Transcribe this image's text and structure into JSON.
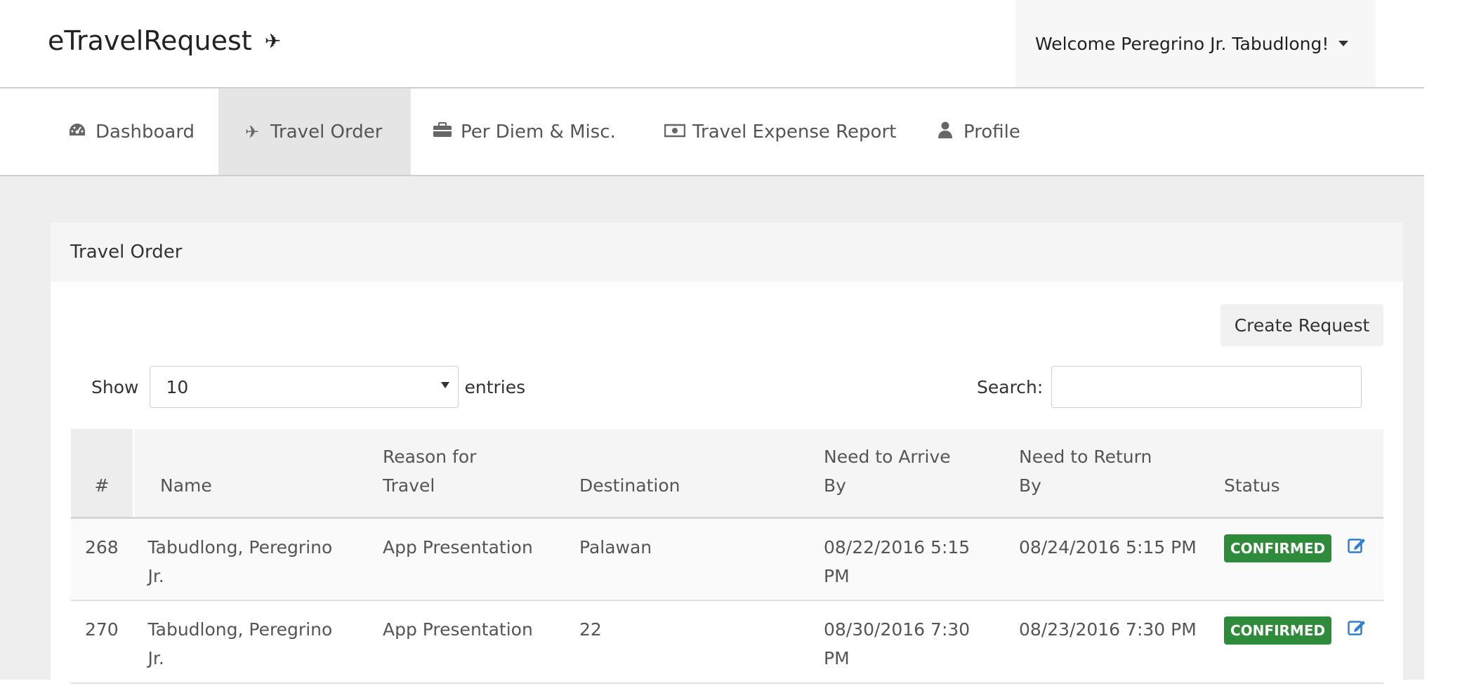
{
  "app": {
    "title": "eTravelRequest",
    "brand_icon": "plane-icon"
  },
  "user_menu": {
    "label": "Welcome Peregrino Jr. Tabudlong!"
  },
  "nav": {
    "items": [
      {
        "label": "Dashboard",
        "icon": "dashboard-icon",
        "glyph": "◔"
      },
      {
        "label": "Travel Order",
        "icon": "plane-icon",
        "glyph": "✈",
        "active": true
      },
      {
        "label": "Per Diem & Misc.",
        "icon": "briefcase-icon",
        "glyph": "▣"
      },
      {
        "label": "Travel Expense Report",
        "icon": "money-icon",
        "glyph": "▭"
      },
      {
        "label": "Profile",
        "icon": "user-icon",
        "glyph": "●"
      }
    ]
  },
  "panel": {
    "title": "Travel Order",
    "create_label": "Create Request"
  },
  "controls": {
    "show_label": "Show",
    "entries_value": "10",
    "entries_label": "entries",
    "search_label": "Search:",
    "search_value": ""
  },
  "table": {
    "headers": {
      "num": "#",
      "name": "Name",
      "reason_l1": "Reason for",
      "reason_l2": "Travel",
      "destination": "Destination",
      "arrive_l1": "Need to Arrive",
      "arrive_l2": "By",
      "return_l1": "Need to Return",
      "return_l2": "By",
      "status": "Status"
    },
    "rows": [
      {
        "id": "268",
        "name_l1": "Tabudlong, Peregrino",
        "name_l2": "Jr.",
        "reason": "App Presentation",
        "destination": "Palawan",
        "arrive_l1": "08/22/2016 5:15",
        "arrive_l2": "PM",
        "return": "08/24/2016 5:15 PM",
        "status": "CONFIRMED"
      },
      {
        "id": "270",
        "name_l1": "Tabudlong, Peregrino",
        "name_l2": "Jr.",
        "reason": "App Presentation",
        "destination": "22",
        "arrive_l1": "08/30/2016 7:30",
        "arrive_l2": "PM",
        "return": "08/23/2016 7:30 PM",
        "status": "CONFIRMED"
      }
    ]
  },
  "colors": {
    "confirmed": "#2e8b3a",
    "edit_icon": "#2f7fd1",
    "nav_active_bg": "#e5e5e5"
  }
}
